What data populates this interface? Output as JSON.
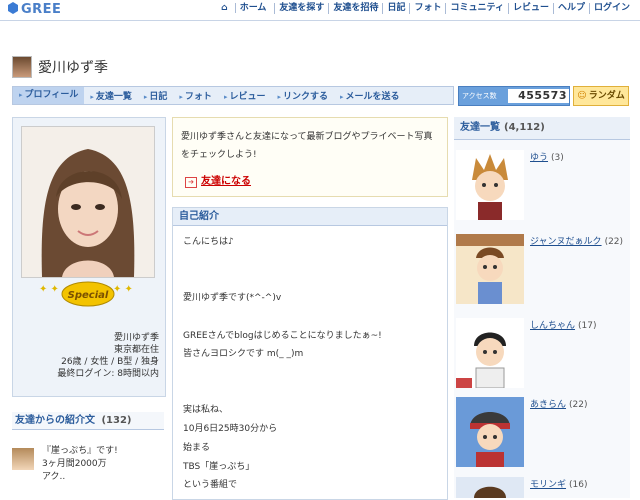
{
  "header": {
    "logo": "GREE",
    "nav": [
      "ホーム",
      "友達を探す",
      "友達を招待",
      "日記",
      "フォト",
      "コミュニティ",
      "レビュー",
      "ヘルプ",
      "ログイン"
    ]
  },
  "profile": {
    "name": "愛川ゆず季",
    "tabs": [
      "プロフィール",
      "友達一覧",
      "日記",
      "フォト",
      "レビュー",
      "リンクする",
      "メールを送る"
    ],
    "access_label": "アクセス数",
    "access_count": "455573",
    "random_label": "ランダム",
    "badge": "Special",
    "info": [
      "愛川ゆず季",
      "東京都在住",
      "26歳 / 女性 / B型 / 独身",
      "最終ログイン: 8時間以内"
    ]
  },
  "friend_prompt": {
    "text": "愛川ゆず季さんと友達になって最新ブログやプライベート写真をチェックしよう!",
    "link": "友達になる"
  },
  "intro": {
    "title": "友達からの紹介文",
    "count": "(132)",
    "items": [
      {
        "lines": [
          "『崖っぷち』です!",
          "3ヶ月間2000万",
          "アク.."
        ]
      }
    ]
  },
  "self_intro": {
    "title": "自己紹介",
    "lines": [
      "こんにちは♪",
      "愛川ゆず季です(*^-^)v",
      "GREEさんでblogはじめることになりましたぁ~!",
      "皆さんヨロシクです m(_ _)m",
      "実は私ね、",
      "10月6日25時30分から",
      "始まる",
      "TBS「崖っぷち」",
      "という番組で"
    ]
  },
  "friends": {
    "title": "友達一覧",
    "count": "(4,112)",
    "items": [
      {
        "name": "ゆう",
        "count": "(3)"
      },
      {
        "name": "ジャンヌだぁルク",
        "count": "(22)"
      },
      {
        "name": "しんちゃん",
        "count": "(17)"
      },
      {
        "name": "あきらん",
        "count": "(22)"
      },
      {
        "name": "モリンギ",
        "count": "(16)"
      }
    ]
  },
  "colors": {
    "accent": "#2b5c9c",
    "link": "#1f4f8f",
    "red_link": "#cc0000",
    "access_bg": "#6aa0dc"
  }
}
